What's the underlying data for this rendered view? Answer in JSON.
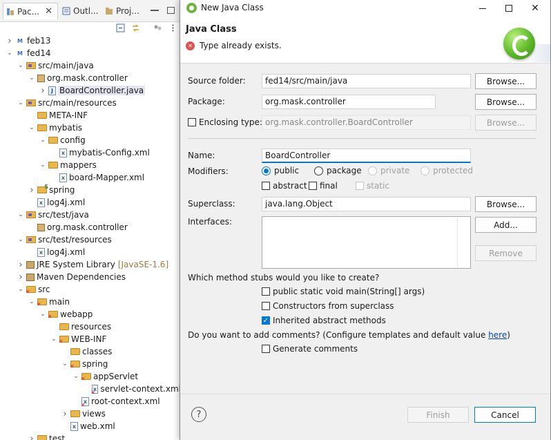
{
  "explorer": {
    "tabs": [
      {
        "label": "Pac..."
      },
      {
        "label": "Outl..."
      },
      {
        "label": "Proj..."
      }
    ],
    "tree": [
      {
        "depth": 0,
        "chev": "right",
        "icon": "proj",
        "label": "feb13"
      },
      {
        "depth": 0,
        "chev": "down",
        "icon": "proj",
        "label": "fed14"
      },
      {
        "depth": 1,
        "chev": "down",
        "icon": "srcfolder",
        "label": "src/main/java"
      },
      {
        "depth": 2,
        "chev": "down",
        "icon": "pkg",
        "label": "org.mask.controller"
      },
      {
        "depth": 3,
        "chev": "right",
        "icon": "java",
        "label": "BoardController.java",
        "selected": true
      },
      {
        "depth": 1,
        "chev": "down",
        "icon": "srcfolder",
        "label": "src/main/resources"
      },
      {
        "depth": 2,
        "chev": "",
        "icon": "folder",
        "label": "META-INF"
      },
      {
        "depth": 2,
        "chev": "down",
        "icon": "folder",
        "label": "mybatis"
      },
      {
        "depth": 3,
        "chev": "down",
        "icon": "folder",
        "label": "config"
      },
      {
        "depth": 4,
        "chev": "",
        "icon": "xml",
        "label": "mybatis-Config.xml"
      },
      {
        "depth": 3,
        "chev": "down",
        "icon": "folder",
        "label": "mappers"
      },
      {
        "depth": 4,
        "chev": "",
        "icon": "xml",
        "label": "board-Mapper.xml"
      },
      {
        "depth": 2,
        "chev": "right",
        "icon": "spring",
        "label": "spring"
      },
      {
        "depth": 2,
        "chev": "",
        "icon": "xml",
        "label": "log4j.xml"
      },
      {
        "depth": 1,
        "chev": "down",
        "icon": "srcfolder",
        "label": "src/test/java"
      },
      {
        "depth": 2,
        "chev": "",
        "icon": "pkg",
        "label": "org.mask.controller"
      },
      {
        "depth": 1,
        "chev": "down",
        "icon": "srcfolder",
        "label": "src/test/resources"
      },
      {
        "depth": 2,
        "chev": "",
        "icon": "xml",
        "label": "log4j.xml"
      },
      {
        "depth": 1,
        "chev": "right",
        "icon": "lib",
        "label": "JRE System Library",
        "suffix": "[JavaSE-1.6]"
      },
      {
        "depth": 1,
        "chev": "right",
        "icon": "lib",
        "label": "Maven Dependencies"
      },
      {
        "depth": 1,
        "chev": "down",
        "icon": "errfolder",
        "label": "src"
      },
      {
        "depth": 2,
        "chev": "down",
        "icon": "errfolder",
        "label": "main"
      },
      {
        "depth": 3,
        "chev": "down",
        "icon": "errfolder",
        "label": "webapp"
      },
      {
        "depth": 4,
        "chev": "",
        "icon": "folder",
        "label": "resources"
      },
      {
        "depth": 4,
        "chev": "down",
        "icon": "errfolder",
        "label": "WEB-INF"
      },
      {
        "depth": 5,
        "chev": "",
        "icon": "folder",
        "label": "classes"
      },
      {
        "depth": 5,
        "chev": "down",
        "icon": "errfolder",
        "label": "spring"
      },
      {
        "depth": 6,
        "chev": "down",
        "icon": "errfolder",
        "label": "appServlet"
      },
      {
        "depth": 7,
        "chev": "",
        "icon": "errxml",
        "label": "servlet-context.xml"
      },
      {
        "depth": 6,
        "chev": "",
        "icon": "errxml",
        "label": "root-context.xml"
      },
      {
        "depth": 5,
        "chev": "right",
        "icon": "folder",
        "label": "views"
      },
      {
        "depth": 5,
        "chev": "",
        "icon": "xml",
        "label": "web.xml"
      },
      {
        "depth": 2,
        "chev": "right",
        "icon": "folder",
        "label": "test"
      }
    ]
  },
  "dialog": {
    "window_title": "New Java Class",
    "header_title": "Java Class",
    "header_message": "Type already exists.",
    "source_folder": {
      "label": "Source folder:",
      "value": "fed14/src/main/java",
      "browse": "Browse..."
    },
    "package": {
      "label": "Package:",
      "value": "org.mask.controller",
      "browse": "Browse..."
    },
    "enclosing": {
      "label": "Enclosing type:",
      "value": "org.mask.controller.BoardController",
      "browse": "Browse...",
      "checked": false
    },
    "name": {
      "label": "Name:",
      "value": "BoardController"
    },
    "modifiers": {
      "label": "Modifiers:",
      "public": "public",
      "package": "package",
      "private": "private",
      "protected": "protected",
      "abstract": "abstract",
      "final": "final",
      "static": "static",
      "selected": "public"
    },
    "superclass": {
      "label": "Superclass:",
      "value": "java.lang.Object",
      "browse": "Browse..."
    },
    "interfaces": {
      "label": "Interfaces:",
      "add": "Add...",
      "remove": "Remove"
    },
    "stubs": {
      "question": "Which method stubs would you like to create?",
      "main": "public static void main(String[] args)",
      "constructors": "Constructors from superclass",
      "inherited": "Inherited abstract methods",
      "main_checked": false,
      "constructors_checked": false,
      "inherited_checked": true
    },
    "comments": {
      "question": "Do you want to add comments? (Configure templates and default value ",
      "link": "here",
      "close_paren": ")",
      "generate": "Generate comments",
      "generate_checked": false
    },
    "footer": {
      "help": "?",
      "finish": "Finish",
      "cancel": "Cancel"
    }
  }
}
